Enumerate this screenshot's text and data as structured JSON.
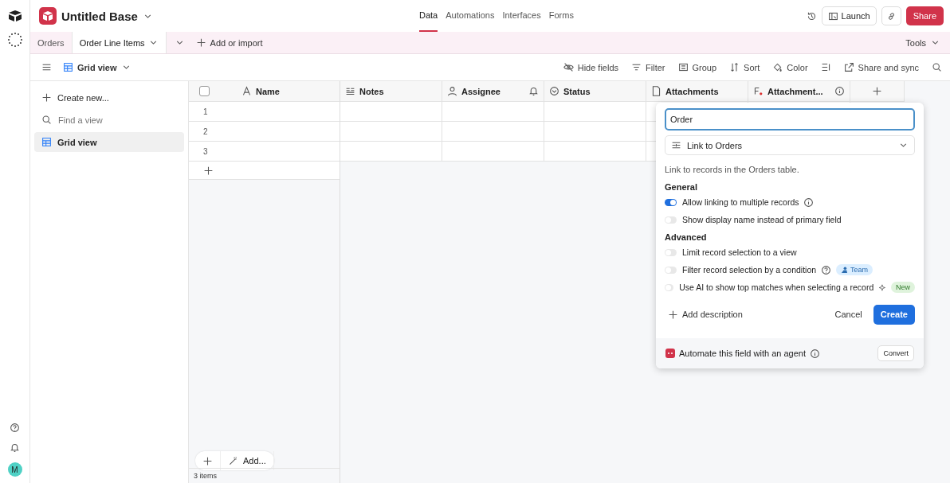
{
  "rail": {
    "avatar": "M"
  },
  "base": {
    "title": "Untitled Base"
  },
  "nav": [
    {
      "label": "Data",
      "selected": true
    },
    {
      "label": "Automations",
      "selected": false
    },
    {
      "label": "Interfaces",
      "selected": false
    },
    {
      "label": "Forms",
      "selected": false
    }
  ],
  "top_actions": {
    "launch": "Launch",
    "share": "Share"
  },
  "table_tabs": [
    {
      "label": "Orders",
      "selected": false
    },
    {
      "label": "Order Line Items",
      "selected": true
    }
  ],
  "add_import": "Add or import",
  "tools": "Tools",
  "view": {
    "name": "Grid view"
  },
  "toolbar": [
    {
      "kind": "hide",
      "label": "Hide fields"
    },
    {
      "kind": "filter",
      "label": "Filter"
    },
    {
      "kind": "group",
      "label": "Group"
    },
    {
      "kind": "sort",
      "label": "Sort"
    },
    {
      "kind": "color",
      "label": "Color"
    },
    {
      "kind": "height"
    },
    {
      "kind": "share",
      "label": "Share and sync"
    },
    {
      "kind": "search"
    }
  ],
  "sidebar": {
    "create": "Create new...",
    "search_placeholder": "Find a view",
    "views": [
      {
        "name": "Grid view",
        "selected": true
      }
    ]
  },
  "grid": {
    "columns": [
      {
        "kind": "text",
        "label": "Name"
      },
      {
        "kind": "notes",
        "label": "Notes"
      },
      {
        "kind": "user",
        "label": "Assignee",
        "bell": true
      },
      {
        "kind": "status",
        "label": "Status"
      },
      {
        "kind": "file",
        "label": "Attachments"
      },
      {
        "kind": "ai",
        "label": "Attachment...",
        "info": true
      }
    ],
    "select_all": {
      "checked": false
    },
    "rows": [
      "1",
      "2",
      "3"
    ],
    "add": "Add...",
    "footer": "3 items"
  },
  "field_editor": {
    "name_value": "Order",
    "type": "Link to Orders",
    "description": "Link to records in the Orders table.",
    "sections": [
      {
        "title": "General",
        "options": [
          {
            "label": "Allow linking to multiple records",
            "on": true,
            "info": true
          },
          {
            "label": "Show display name instead of primary field",
            "on": false
          }
        ]
      },
      {
        "title": "Advanced",
        "options": [
          {
            "label": "Limit record selection to a view",
            "on": false
          },
          {
            "label": "Filter record selection by a condition",
            "on": false,
            "help": true,
            "badge": {
              "kind": "team",
              "label": "Team"
            }
          },
          {
            "label": "Use AI to show top matches when selecting a record",
            "on": false,
            "sparkle": true,
            "badge": {
              "kind": "new",
              "label": "New"
            }
          }
        ]
      }
    ],
    "add_description": "Add description",
    "cancel": "Cancel",
    "create": "Create",
    "agent": {
      "label": "Automate this field with an agent",
      "button": "Convert"
    }
  }
}
